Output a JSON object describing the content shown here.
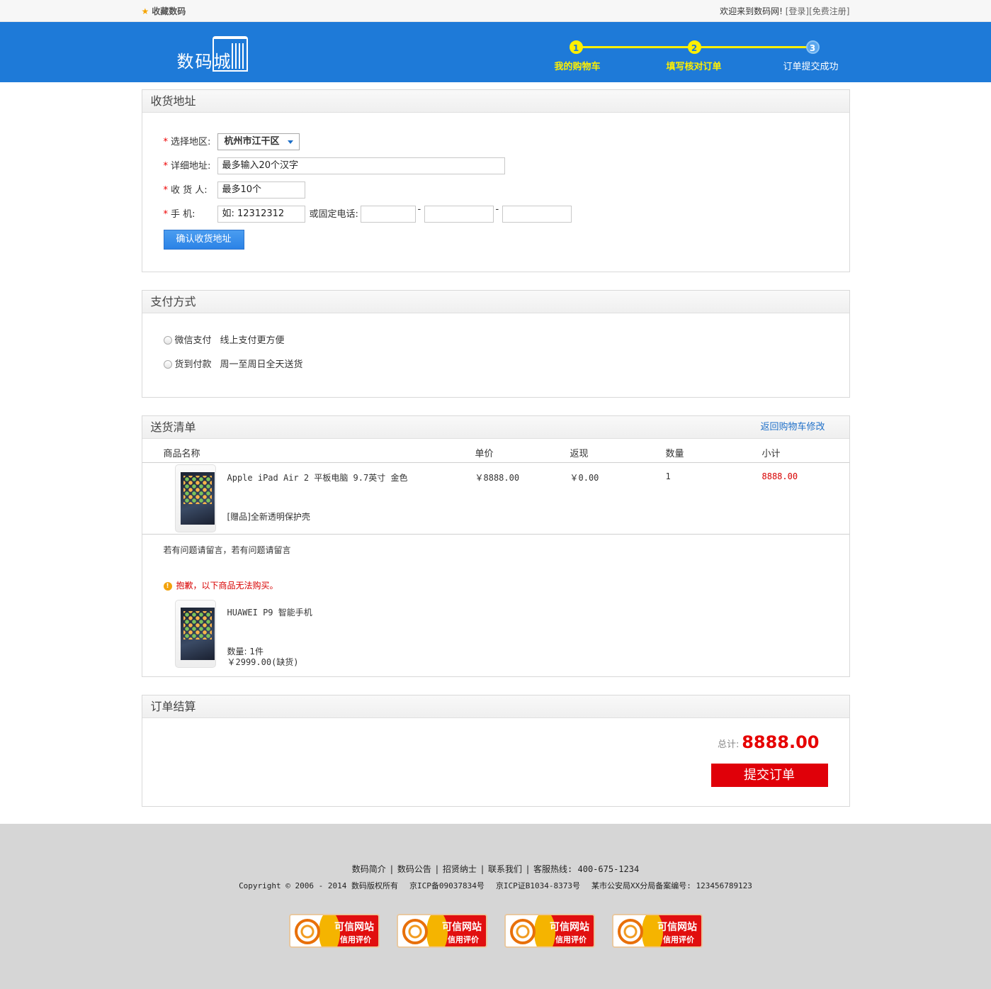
{
  "topbar": {
    "favorite": "收藏数码",
    "welcome": "欢迎来到数码网!",
    "login": "[登录]",
    "register": "[免费注册]"
  },
  "header": {
    "logo_text": "数码城",
    "steps": [
      {
        "num": "1",
        "label": "我的购物车"
      },
      {
        "num": "2",
        "label": "填写核对订单"
      },
      {
        "num": "3",
        "label": "订单提交成功"
      }
    ]
  },
  "address": {
    "title": "收货地址",
    "region_label": "选择地区:",
    "region_value": "杭州市江干区",
    "detail_label": "详细地址:",
    "detail_placeholder": "最多输入20个汉字",
    "receiver_label": "收 货 人:",
    "receiver_placeholder": "最多10个",
    "phone_label": "手  机:",
    "phone_placeholder": "如: 12312312",
    "landline_label": "或固定电话:",
    "dash": "-",
    "confirm_button": "确认收货地址"
  },
  "payment": {
    "title": "支付方式",
    "options": [
      {
        "name": "微信支付",
        "desc": "线上支付更方便"
      },
      {
        "name": "货到付款",
        "desc": "周一至周日全天送货"
      }
    ]
  },
  "delivery": {
    "title": "送货清单",
    "back_link": "返回购物车修改",
    "columns": [
      "商品名称",
      "单价",
      "返现",
      "数量",
      "小计"
    ],
    "item": {
      "name": "Apple iPad Air 2 平板电脑 9.7英寸 金色",
      "gift": "[赠品]全新透明保护壳",
      "price": "￥8888.00",
      "cashback": "￥0.00",
      "qty": "1",
      "subtotal": "8888.00"
    },
    "note": "若有问题请留言，若有问题请留言",
    "unavailable_msg": "抱歉，以下商品无法购买。",
    "unavailable_item": {
      "name": "HUAWEI P9 智能手机",
      "qty": "数量: 1件",
      "price": "￥2999.00(缺货)"
    }
  },
  "summary": {
    "title": "订单结算",
    "total_label": "总计:",
    "total_value": "8888.00",
    "submit_button": "提交订单"
  },
  "footer": {
    "links": [
      "数码简介",
      "数码公告",
      "招贤纳士",
      "联系我们",
      "客服热线: 400-675-1234"
    ],
    "copyright": "Copyright © 2006 - 2014 数码版权所有",
    "icp1": "京ICP备09037834号",
    "icp2": "京ICP证B1034-8373号",
    "police": "某市公安局XX分局备案编号: 123456789123",
    "badges": [
      {
        "line1": "可信网站",
        "line2": "信用评价"
      },
      {
        "line1": "可信网站",
        "line2": "信用评价"
      },
      {
        "line1": "可信网站",
        "line2": "信用评价"
      },
      {
        "line1": "可信网站",
        "line2": "信用评价"
      }
    ]
  },
  "colors": {
    "brand_blue": "#1e7ad8",
    "step_yellow": "#ffef00",
    "price_red": "#e60000"
  }
}
